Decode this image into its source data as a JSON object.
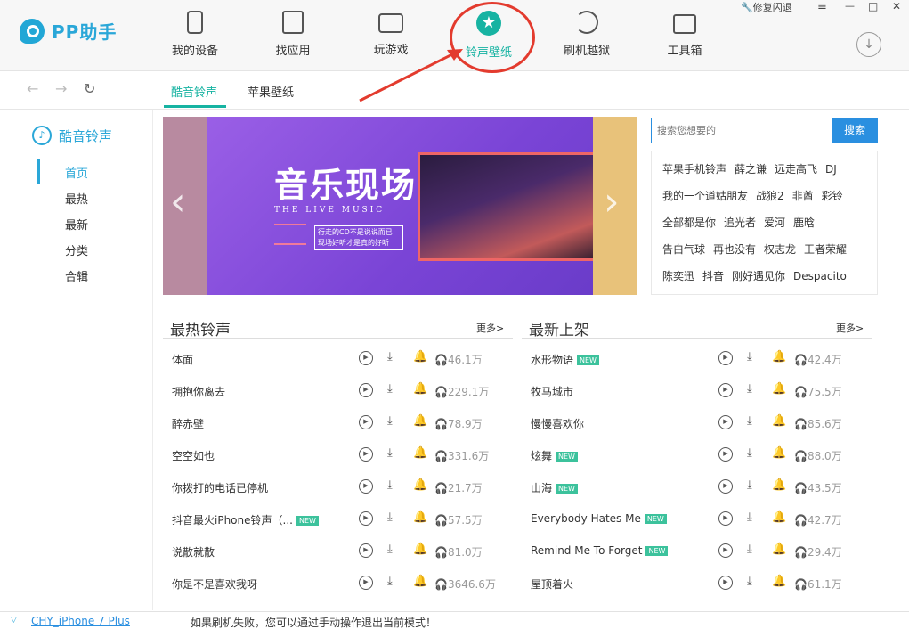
{
  "app": {
    "logo_text": "PP助手"
  },
  "nav": [
    {
      "label": "我的设备",
      "icon": "phone-icon"
    },
    {
      "label": "找应用",
      "icon": "shopping-bag-icon"
    },
    {
      "label": "玩游戏",
      "icon": "gamepad-icon"
    },
    {
      "label": "铃声壁纸",
      "icon": "star-icon",
      "active": true
    },
    {
      "label": "刷机越狱",
      "icon": "refresh-icon"
    },
    {
      "label": "工具箱",
      "icon": "toolbox-icon"
    }
  ],
  "window": {
    "repair": "修复闪退",
    "minimize": "—",
    "maximize": "□",
    "close": "✕",
    "menu": "≡"
  },
  "subtabs": {
    "ringtones": "酷音铃声",
    "wallpapers": "苹果壁纸"
  },
  "sidebar": {
    "title": "酷音铃声",
    "items": [
      "首页",
      "最热",
      "最新",
      "分类",
      "合辑"
    ]
  },
  "banner": {
    "title": "音乐现场",
    "subtitle": "THE LIVE MUSIC",
    "desc": "行走的CD不是说说而已 现场好听才是真的好听"
  },
  "search": {
    "placeholder": "搜索您想要的",
    "button": "搜索"
  },
  "hot_tags": [
    [
      "苹果手机铃声",
      "薛之谦",
      "远走高飞",
      "DJ"
    ],
    [
      "我的一个道姑朋友",
      "战狼2",
      "非酋",
      "彩铃"
    ],
    [
      "全部都是你",
      "追光者",
      "爱河",
      "鹿晗"
    ],
    [
      "告白气球",
      "再也没有",
      "权志龙",
      "王者荣耀"
    ],
    [
      "陈奕迅",
      "抖音",
      "刚好遇见你",
      "Despacito"
    ]
  ],
  "hottest": {
    "title": "最热铃声",
    "more": "更多>",
    "rows": [
      {
        "name": "体面",
        "new": false,
        "count": "46.1万"
      },
      {
        "name": "拥抱你离去",
        "new": false,
        "count": "229.1万"
      },
      {
        "name": "醉赤壁",
        "new": false,
        "count": "78.9万"
      },
      {
        "name": "空空如也",
        "new": false,
        "count": "331.6万"
      },
      {
        "name": "你拨打的电话已停机",
        "new": false,
        "count": "21.7万"
      },
      {
        "name": "抖音最火iPhone铃声（...",
        "new": true,
        "count": "57.5万"
      },
      {
        "name": "说散就散",
        "new": false,
        "count": "81.0万"
      },
      {
        "name": "你是不是喜欢我呀",
        "new": false,
        "count": "3646.6万"
      }
    ]
  },
  "newest": {
    "title": "最新上架",
    "more": "更多>",
    "rows": [
      {
        "name": "水形物语",
        "new": true,
        "count": "42.4万"
      },
      {
        "name": "牧马城市",
        "new": false,
        "count": "75.5万"
      },
      {
        "name": "慢慢喜欢你",
        "new": false,
        "count": "85.6万"
      },
      {
        "name": "炫舞",
        "new": true,
        "count": "88.0万"
      },
      {
        "name": "山海",
        "new": true,
        "count": "43.5万"
      },
      {
        "name": "Everybody Hates Me",
        "new": true,
        "count": "42.7万"
      },
      {
        "name": "Remind Me To Forget",
        "new": true,
        "count": "29.4万"
      },
      {
        "name": "屋顶着火",
        "new": false,
        "count": "61.1万"
      }
    ]
  },
  "badge_text": "NEW",
  "status": {
    "device": "CHY_iPhone 7 Plus",
    "message": "如果刷机失败，您可以通过手动操作退出当前模式！"
  },
  "colors": {
    "accent": "#17b3a2",
    "brand_blue": "#2a8fe0",
    "annotation_red": "#e33b2e"
  }
}
